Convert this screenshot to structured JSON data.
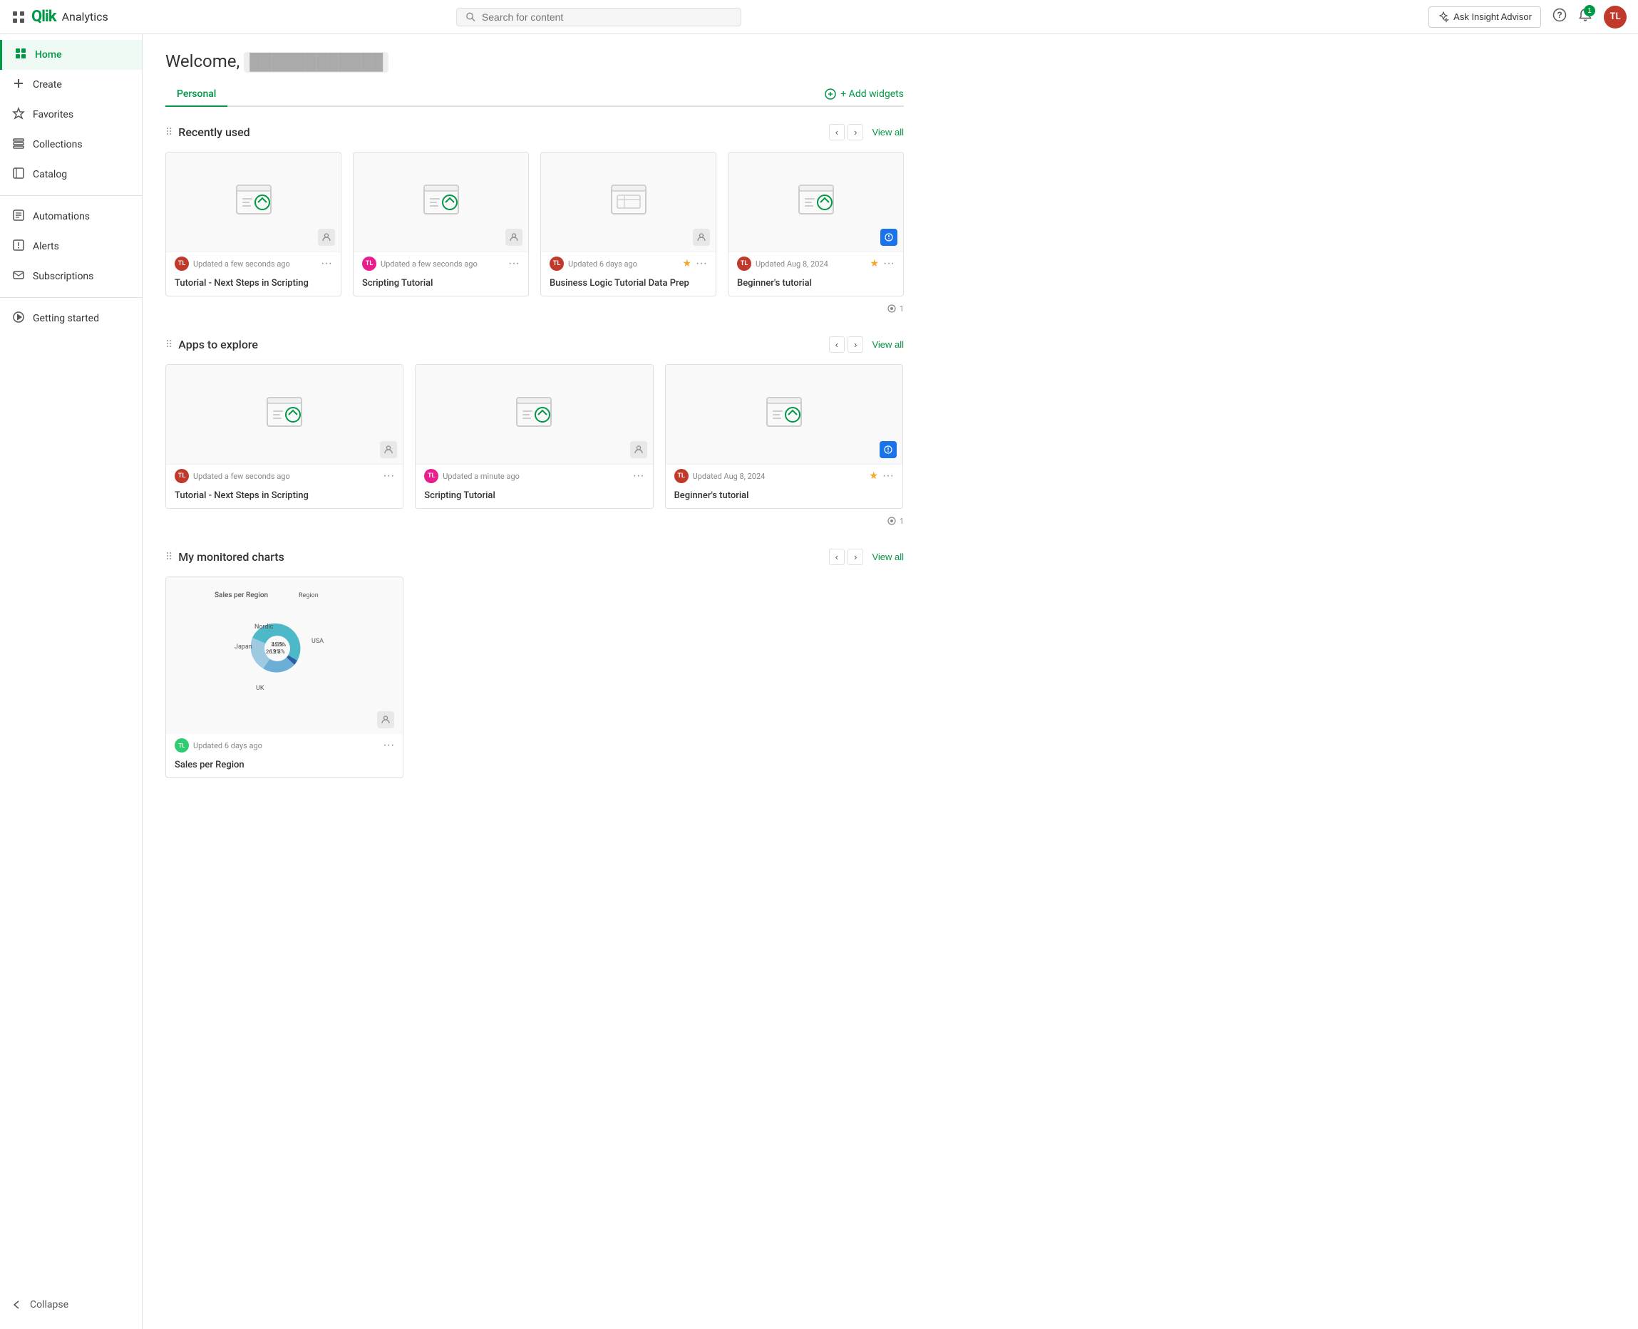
{
  "topnav": {
    "app_name": "Analytics",
    "search_placeholder": "Search for content",
    "insight_advisor_label": "Ask Insight Advisor",
    "notification_count": "1",
    "avatar_initials": "TL"
  },
  "sidebar": {
    "items": [
      {
        "id": "home",
        "label": "Home",
        "icon": "⊞",
        "active": true
      },
      {
        "id": "create",
        "label": "Create",
        "icon": "+",
        "active": false
      },
      {
        "id": "favorites",
        "label": "Favorites",
        "icon": "☆",
        "active": false
      },
      {
        "id": "collections",
        "label": "Collections",
        "icon": "☰",
        "active": false
      },
      {
        "id": "catalog",
        "label": "Catalog",
        "icon": "⊡",
        "active": false
      },
      {
        "id": "automations",
        "label": "Automations",
        "icon": "⚙",
        "active": false
      },
      {
        "id": "alerts",
        "label": "Alerts",
        "icon": "⊟",
        "active": false
      },
      {
        "id": "subscriptions",
        "label": "Subscriptions",
        "icon": "✉",
        "active": false
      },
      {
        "id": "getting-started",
        "label": "Getting started",
        "icon": "🚀",
        "active": false
      }
    ],
    "collapse_label": "Collapse"
  },
  "main": {
    "welcome_prefix": "Welcome,",
    "welcome_name": "████████████",
    "tabs": [
      {
        "label": "Personal",
        "active": true
      }
    ],
    "add_widgets_label": "+ Add widgets",
    "sections": [
      {
        "id": "recently-used",
        "title": "Recently used",
        "view_all": "View all",
        "cards": [
          {
            "title": "Tutorial - Next Steps in Scripting",
            "updated": "Updated a few seconds ago",
            "avatar_color": "#c0392b",
            "avatar_initials": "TL",
            "starred": false,
            "badge_type": "user",
            "has_views": false
          },
          {
            "title": "Scripting Tutorial",
            "updated": "Updated a few seconds ago",
            "avatar_color": "#e91e8c",
            "avatar_initials": "TL",
            "starred": false,
            "badge_type": "user",
            "has_views": false
          },
          {
            "title": "Business Logic Tutorial Data Prep",
            "updated": "Updated 6 days ago",
            "avatar_color": "#c0392b",
            "avatar_initials": "TL",
            "starred": true,
            "badge_type": "user",
            "has_views": false
          },
          {
            "title": "Beginner's tutorial",
            "updated": "Updated Aug 8, 2024",
            "avatar_color": "#c0392b",
            "avatar_initials": "TL",
            "starred": true,
            "badge_type": "blue",
            "has_views": true,
            "views": "1"
          }
        ]
      },
      {
        "id": "apps-to-explore",
        "title": "Apps to explore",
        "view_all": "View all",
        "cards": [
          {
            "title": "Tutorial - Next Steps in Scripting",
            "updated": "Updated a few seconds ago",
            "avatar_color": "#c0392b",
            "avatar_initials": "TL",
            "starred": false,
            "badge_type": "user",
            "has_views": false
          },
          {
            "title": "Scripting Tutorial",
            "updated": "Updated a minute ago",
            "avatar_color": "#e91e8c",
            "avatar_initials": "TL",
            "starred": false,
            "badge_type": "user",
            "has_views": false
          },
          {
            "title": "Beginner's tutorial",
            "updated": "Updated Aug 8, 2024",
            "avatar_color": "#c0392b",
            "avatar_initials": "TL",
            "starred": true,
            "badge_type": "blue",
            "has_views": true,
            "views": "1"
          }
        ]
      },
      {
        "id": "my-monitored-charts",
        "title": "My monitored charts",
        "view_all": "View all",
        "charts": [
          {
            "title": "Sales per Region",
            "updated": "Updated 6 days ago",
            "avatar_color": "#2ecc71",
            "avatar_initials": "TL"
          }
        ]
      }
    ]
  },
  "chart_data": {
    "title": "Sales per Region",
    "subtitle": "Region",
    "segments": [
      {
        "label": "USA",
        "value": 45.5,
        "color": "#4db8c8"
      },
      {
        "label": "Nordic",
        "value": 3.3,
        "color": "#2b5ea7"
      },
      {
        "label": "Japan",
        "value": 12.3,
        "color": "#6baed6"
      },
      {
        "label": "UK",
        "value": 26.9,
        "color": "#9ecae1"
      }
    ]
  }
}
